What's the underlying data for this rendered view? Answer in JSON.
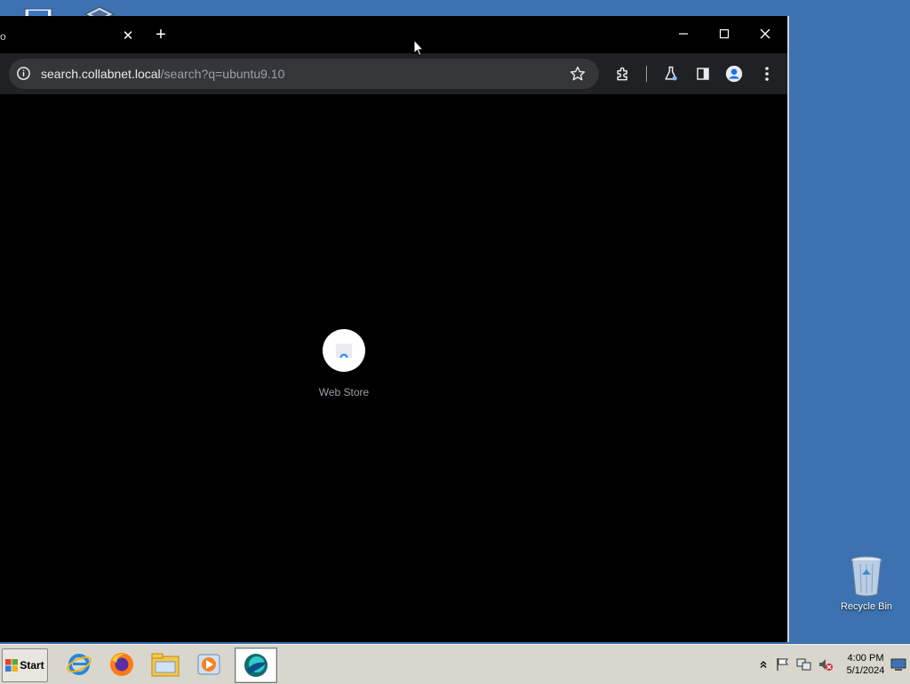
{
  "browser": {
    "tab": {
      "title": "o",
      "close_glyph": "✕"
    },
    "new_tab_glyph": "+",
    "omnibox": {
      "host": "search.collabnet.local",
      "path": "/search?q=ubuntu9.10"
    },
    "shortcuts": [
      {
        "label": "Web Store",
        "icon": "web-store-icon"
      }
    ]
  },
  "desktop": {
    "recycle_bin_label": "Recycle Bin"
  },
  "taskbar": {
    "start_label": "Start",
    "apps": [
      {
        "name": "internet-explorer-icon"
      },
      {
        "name": "firefox-icon"
      },
      {
        "name": "file-explorer-icon"
      },
      {
        "name": "media-player-icon"
      },
      {
        "name": "browser-icon",
        "active": true
      }
    ],
    "clock": {
      "time": "4:00 PM",
      "date": "5/1/2024"
    }
  }
}
